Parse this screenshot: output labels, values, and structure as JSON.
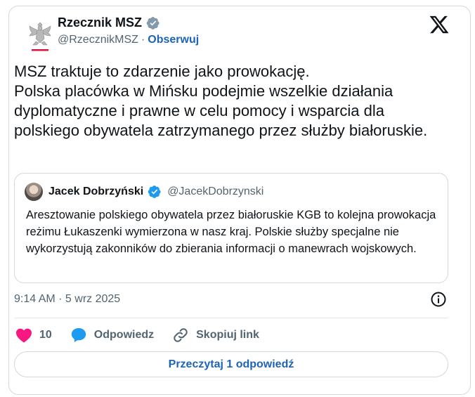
{
  "author": {
    "display_name": "Rzecznik MSZ",
    "handle": "@RzecznikMSZ",
    "separator": "·",
    "follow_label": "Obserwuj",
    "avatar_icon": "polish-eagle-emblem-icon"
  },
  "tweet": {
    "text": "MSZ traktuje to zdarzenie jako prowokację.\nPolska placówka w Mińsku podejmie wszelkie działania dyplomatyczne i prawne w celu pomocy i wsparcia dla polskiego obywatela zatrzymanego przez służby białoruskie.",
    "timestamp": "9:14 AM · 5 wrz 2025"
  },
  "quote": {
    "display_name": "Jacek Dobrzyński",
    "handle": "@JacekDobrzynski",
    "text": "Aresztowanie polskiego obywatela przez białoruskie KGB to kolejna prowokacja reżimu Łukaszenki wymierzona w nasz kraj. Polskie służby specjalne nie wykorzystują zakonników do zbierania informacji o manewrach wojskowych."
  },
  "actions": {
    "likes_count": "10",
    "reply_label": "Odpowiedz",
    "copy_link_label": "Skopiuj link"
  },
  "read_replies_label": "Przeczytaj 1 odpowiedź",
  "colors": {
    "accent": "#1d64b8",
    "verified": "#1d9bf0",
    "like": "#f91880",
    "gray_text": "#536471"
  }
}
